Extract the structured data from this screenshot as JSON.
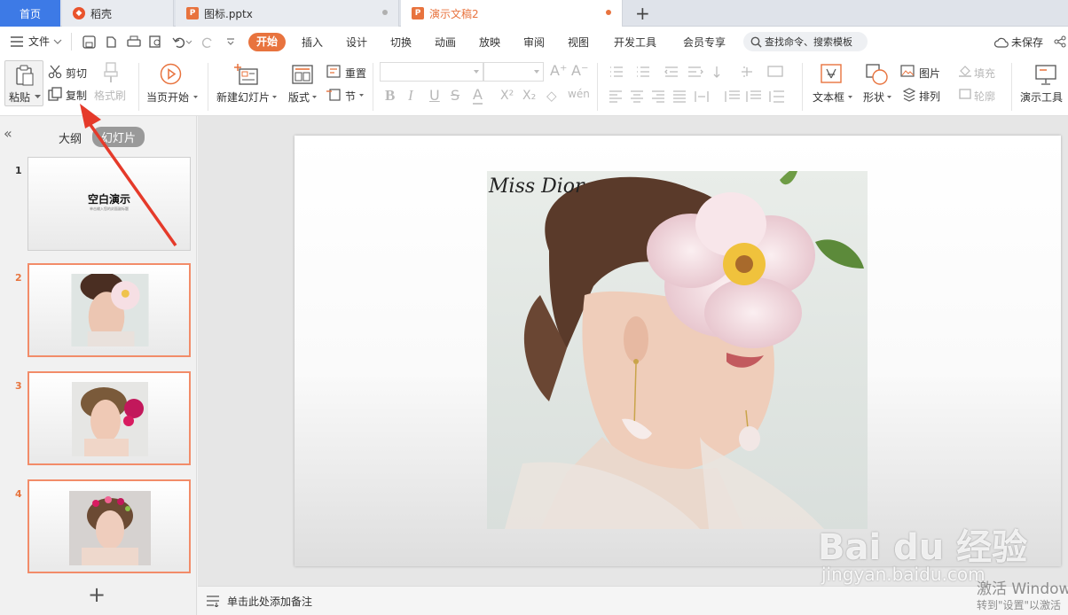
{
  "tabs": {
    "home": "首页",
    "daoke": "稻壳",
    "file1": "图标.pptx",
    "file2": "演示文稿2",
    "new_tab": "+"
  },
  "menu": {
    "file": "文件",
    "items": [
      "开始",
      "插入",
      "设计",
      "切换",
      "动画",
      "放映",
      "审阅",
      "视图",
      "开发工具",
      "会员专享"
    ],
    "search": "查找命令、搜索模板",
    "unsaved": "未保存"
  },
  "ribbon": {
    "paste": "粘贴",
    "cut": "剪切",
    "copy": "复制",
    "format_painter": "格式刷",
    "play_current": "当页开始",
    "new_slide": "新建幻灯片",
    "layout": "版式",
    "reset": "重置",
    "section": "节",
    "font_style_chars": [
      "B",
      "I",
      "U",
      "S"
    ],
    "text_box": "文本框",
    "shape": "形状",
    "picture": "图片",
    "arrange": "排列",
    "fill": "填充",
    "outline": "轮廓",
    "presentation_tools": "演示工具"
  },
  "panel": {
    "outline_tab": "大纲",
    "slides_tab": "幻灯片",
    "collapse": "«",
    "add": "+",
    "slides": [
      {
        "num": "1",
        "title": "空白演示",
        "subtitle": "单击输入您的封面副标题"
      },
      {
        "num": "2"
      },
      {
        "num": "3"
      },
      {
        "num": "4"
      }
    ]
  },
  "slide": {
    "script_text": "Miss Dior"
  },
  "notes": {
    "placeholder": "单击此处添加备注"
  },
  "overlay": {
    "baidu_logo": "Bai du 经验",
    "watermark_url": "jingyan.baidu.com",
    "activate_line1": "激活 Windows",
    "activate_line2": "转到\"设置\"以激活"
  },
  "colors": {
    "accent": "#e8733e",
    "home_tab": "#3d7ae6",
    "selected_border": "#f28c69",
    "arrow": "#e53a2a"
  }
}
